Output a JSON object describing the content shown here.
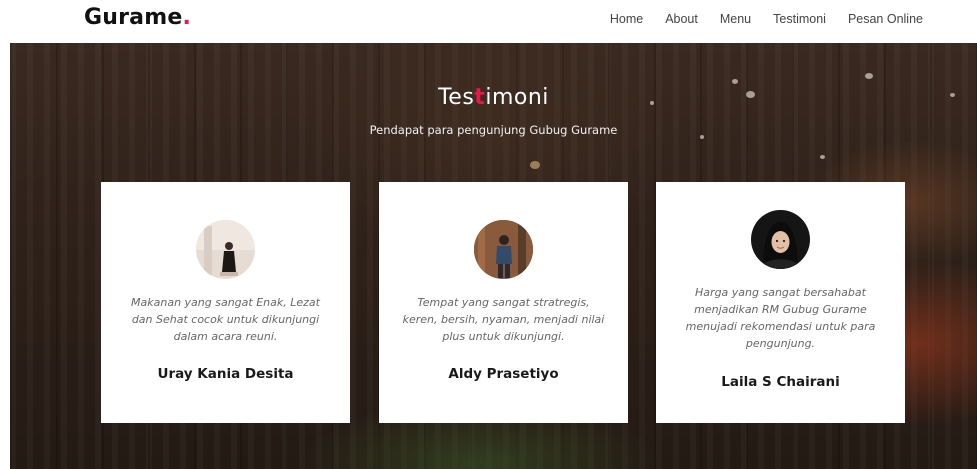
{
  "navbar": {
    "brand": "Gurame",
    "brand_dot": ".",
    "links": [
      "Home",
      "About",
      "Menu",
      "Testimoni",
      "Pesan Online"
    ]
  },
  "hero": {
    "title_before": "Tes",
    "title_accent": "t",
    "title_after": "imoni",
    "subtitle": "Pendapat para pengunjung Gubug Gurame"
  },
  "testimonials": [
    {
      "quote": "Makanan yang sangat Enak, Lezat dan Sehat cocok untuk dikunjungi dalam acara reuni.",
      "name": "Uray Kania Desita"
    },
    {
      "quote": "Tempat yang sangat stratregis, keren, bersih, nyaman, menjadi nilai plus untuk dikunjungi.",
      "name": "Aldy Prasetiyo"
    },
    {
      "quote": "Harga yang sangat bersahabat menjadikan RM Gubug Gurame menujadi rekomendasi untuk para pengunjung.",
      "name": "Laila S Chairani"
    }
  ],
  "colors": {
    "accent": "#e8184c",
    "card_bg": "#ffffff",
    "quote_text": "#666666"
  }
}
